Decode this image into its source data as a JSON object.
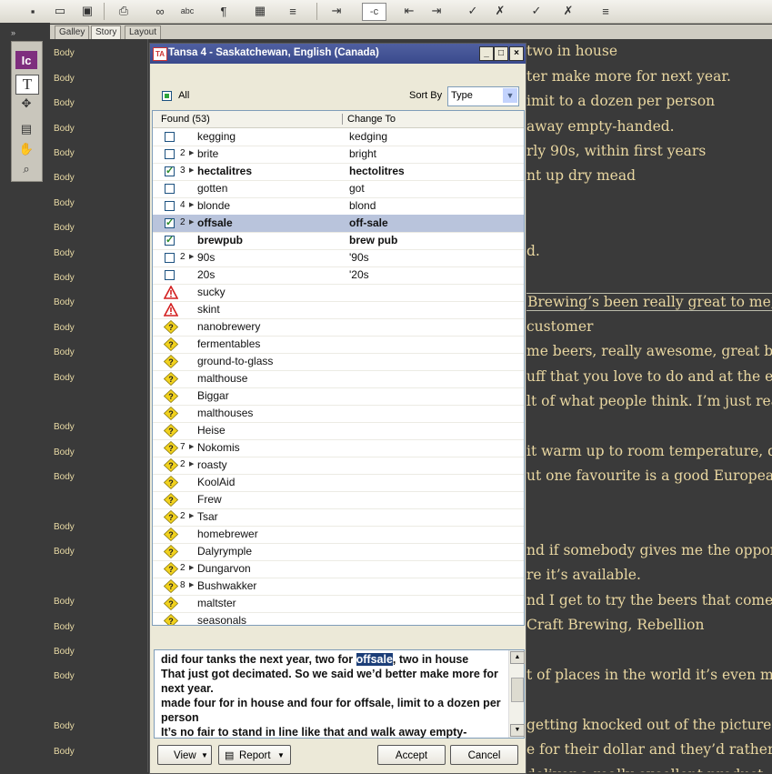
{
  "toolbar": {
    "field_value": "-c"
  },
  "tools_palette": {
    "ic_label": "Ic",
    "text_tool_label": "T"
  },
  "view_tabs": [
    "Galley",
    "Story",
    "Layout"
  ],
  "style_column": {
    "label": "Body"
  },
  "editor_lines": [
    "two in house",
    "ter make more for next year.",
    "imit to a dozen per person",
    "away empty-handed.",
    "rly 90s, within first years",
    "nt up dry mead",
    "d.",
    "Brewing’s been really great to me, f",
    "customer",
    "me beers, really awesome, great be",
    "uff that you love to do and at the end",
    "lt of what people think. I’m just rea",
    "it warm up to room temperature, da",
    "ut one favourite is a good European",
    "nd if somebody gives me the oppor",
    "re it’s available.",
    "nd I get to try the beers that come d",
    "Craft Brewing, Rebellion",
    "t of places in the world it’s even mo",
    "getting knocked out of the picture in",
    "e for their dollar and they’d rather",
    "deliver a really excellent product, th"
  ],
  "dialog": {
    "title": "Tansa 4 - Saskatchewan, English (Canada)",
    "title_icon_text": "TA",
    "window_buttons": {
      "minimize": "_",
      "maximize": "□",
      "close": "×"
    },
    "all_label": "All",
    "sort_by_label": "Sort By",
    "sort_by_value": "Type",
    "col_found": "Found (53)",
    "col_change": "Change To",
    "rows": [
      {
        "type": "check",
        "checked": false,
        "count": "",
        "arrow": false,
        "found": "kegging",
        "change": "kedging",
        "bold": false
      },
      {
        "type": "check",
        "checked": false,
        "count": "2",
        "arrow": true,
        "found": "brite",
        "change": "bright",
        "bold": false
      },
      {
        "type": "check",
        "checked": true,
        "count": "3",
        "arrow": true,
        "found": "hectalitres",
        "change": "hectolitres",
        "bold": true
      },
      {
        "type": "check",
        "checked": false,
        "count": "",
        "arrow": false,
        "found": "gotten",
        "change": "got",
        "bold": false
      },
      {
        "type": "check",
        "checked": false,
        "count": "4",
        "arrow": true,
        "found": "blonde",
        "change": "blond",
        "bold": false
      },
      {
        "type": "check",
        "checked": true,
        "count": "2",
        "arrow": true,
        "found": "offsale",
        "change": "off-sale",
        "bold": true,
        "selected": true
      },
      {
        "type": "check",
        "checked": true,
        "count": "",
        "arrow": false,
        "found": "brewpub",
        "change": "brew pub",
        "bold": true
      },
      {
        "type": "check",
        "checked": false,
        "count": "2",
        "arrow": true,
        "found": "90s",
        "change": "'90s",
        "bold": false
      },
      {
        "type": "check",
        "checked": false,
        "count": "",
        "arrow": false,
        "found": "20s",
        "change": "'20s",
        "bold": false
      },
      {
        "type": "warn",
        "count": "",
        "arrow": false,
        "found": "sucky",
        "change": ""
      },
      {
        "type": "warn",
        "count": "",
        "arrow": false,
        "found": "skint",
        "change": ""
      },
      {
        "type": "question",
        "count": "",
        "arrow": false,
        "found": "nanobrewery",
        "change": ""
      },
      {
        "type": "question",
        "count": "",
        "arrow": false,
        "found": "fermentables",
        "change": ""
      },
      {
        "type": "question",
        "count": "",
        "arrow": false,
        "found": "ground-to-glass",
        "change": ""
      },
      {
        "type": "question",
        "count": "",
        "arrow": false,
        "found": "malthouse",
        "change": ""
      },
      {
        "type": "question",
        "count": "",
        "arrow": false,
        "found": "Biggar",
        "change": ""
      },
      {
        "type": "question",
        "count": "",
        "arrow": false,
        "found": "malthouses",
        "change": ""
      },
      {
        "type": "question",
        "count": "",
        "arrow": false,
        "found": "Heise",
        "change": ""
      },
      {
        "type": "question",
        "count": "7",
        "arrow": true,
        "found": "Nokomis",
        "change": ""
      },
      {
        "type": "question",
        "count": "2",
        "arrow": true,
        "found": "roasty",
        "change": ""
      },
      {
        "type": "question",
        "count": "",
        "arrow": false,
        "found": "KoolAid",
        "change": ""
      },
      {
        "type": "question",
        "count": "",
        "arrow": false,
        "found": "Frew",
        "change": ""
      },
      {
        "type": "question",
        "count": "2",
        "arrow": true,
        "found": "Tsar",
        "change": ""
      },
      {
        "type": "question",
        "count": "",
        "arrow": false,
        "found": "homebrewer",
        "change": ""
      },
      {
        "type": "question",
        "count": "",
        "arrow": false,
        "found": "Dalyrymple",
        "change": ""
      },
      {
        "type": "question",
        "count": "2",
        "arrow": true,
        "found": "Dungarvon",
        "change": ""
      },
      {
        "type": "question",
        "count": "8",
        "arrow": true,
        "found": "Bushwakker",
        "change": ""
      },
      {
        "type": "question",
        "count": "",
        "arrow": false,
        "found": "maltster",
        "change": ""
      },
      {
        "type": "question",
        "count": "",
        "arrow": false,
        "found": "seasonals",
        "change": ""
      }
    ],
    "context": {
      "line1_before": "did four tanks the next year, two for ",
      "line1_highlight": "offsale",
      "line1_after": ", two in house",
      "line2": "That just got decimated. So we said we’d better make more for next year.",
      "line3": "made four for in house and four for offsale, limit to a dozen per person",
      "line4": "It’s no fair to stand in line like that and walk away empty-"
    },
    "buttons": {
      "view": "View",
      "report": "Report",
      "accept": "Accept",
      "cancel": "Cancel"
    }
  }
}
